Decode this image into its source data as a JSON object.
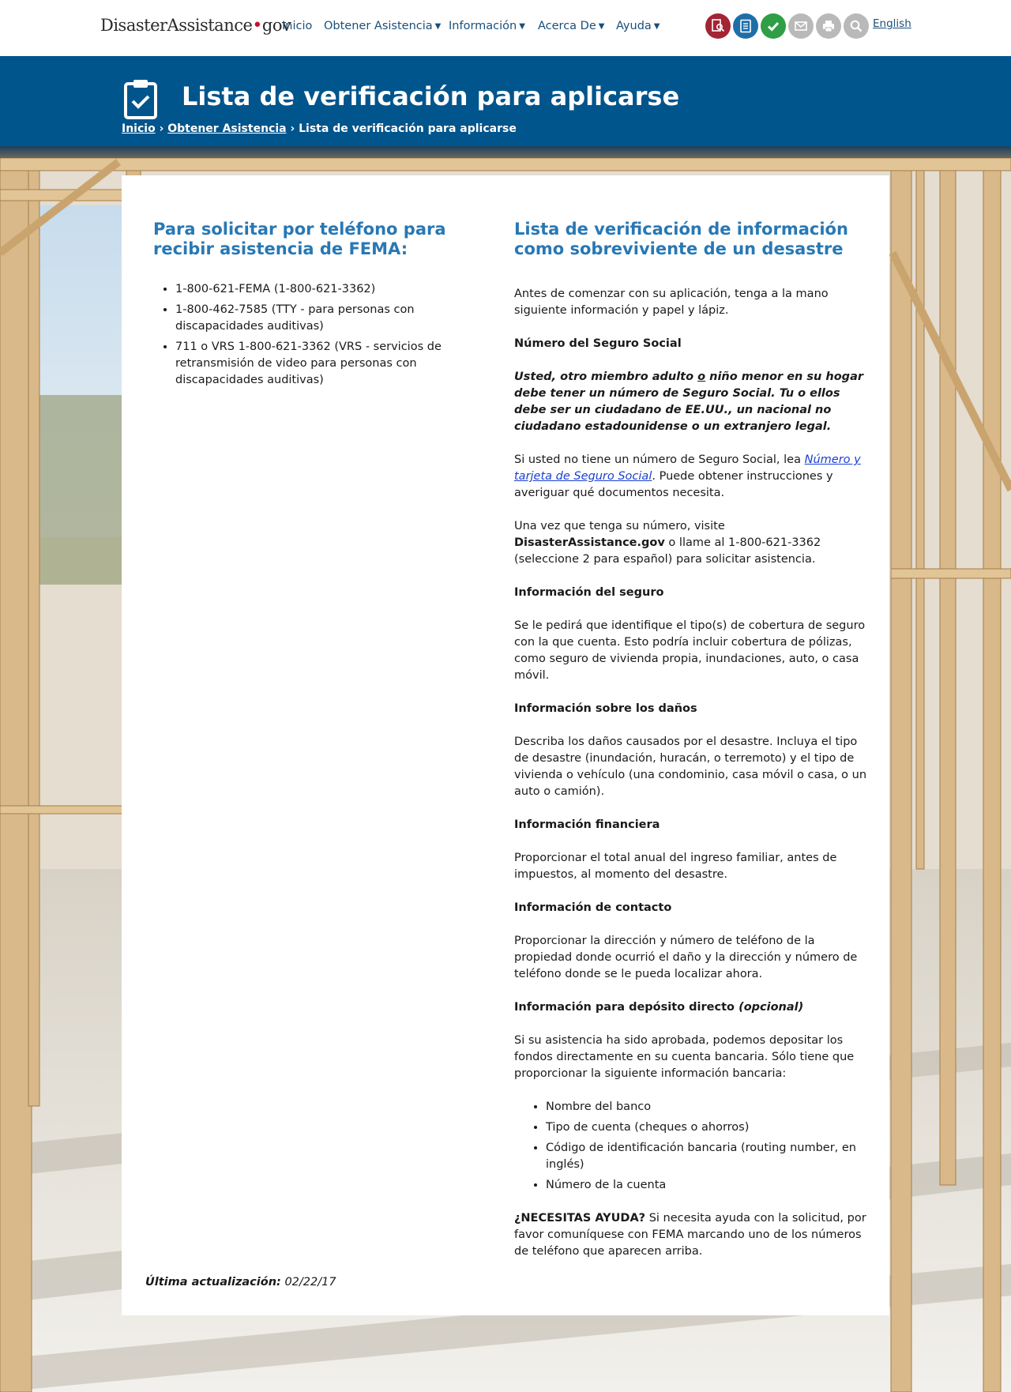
{
  "nav": {
    "logo": {
      "text_main": "DisasterAssistance",
      "text_dot": "•",
      "text_tld": "gov"
    },
    "links": [
      {
        "label": "Inicio",
        "dropdown": false
      },
      {
        "label": "Obtener Asistencia",
        "dropdown": true
      },
      {
        "label": "Información",
        "dropdown": true
      },
      {
        "label": "Acerca De",
        "dropdown": true
      },
      {
        "label": "Ayuda",
        "dropdown": true
      }
    ],
    "tools": [
      {
        "icon": "search-document-icon",
        "color": "#a32434"
      },
      {
        "icon": "checklist-icon",
        "color": "#1e6ea8"
      },
      {
        "icon": "checkmark-icon",
        "color": "#2f9e46"
      },
      {
        "icon": "email-icon",
        "color": "#b9b9b9"
      },
      {
        "icon": "print-icon",
        "color": "#b9b9b9"
      },
      {
        "icon": "search-icon",
        "color": "#b9b9b9"
      }
    ],
    "language_link": "English"
  },
  "banner": {
    "title": "Lista de verificación para aplicarse",
    "icon": "clipboard-check-icon",
    "breadcrumb": [
      {
        "label": "Inicio",
        "link": true
      },
      {
        "label": "›",
        "link": false
      },
      {
        "label": "Obtener Asistencia",
        "link": true
      },
      {
        "label": "›",
        "link": false
      },
      {
        "label": "Lista de verificación para aplicarse",
        "link": false
      }
    ]
  },
  "left": {
    "heading": "Para solicitar por teléfono para recibir asistencia de FEMA:",
    "items": [
      "1-800-621-FEMA (1-800-621-3362)",
      "1-800-462-7585 (TTY - para personas con discapacidades auditivas)",
      "711 o VRS 1-800-621-3362 (VRS - servicios de retransmisión de video para personas con discapacidades auditivas)"
    ]
  },
  "right": {
    "heading": "Lista de verificación de información como sobreviviente de un desastre",
    "intro": "Antes de comenzar con su aplicación, tenga a la mano siguiente información y papel y lápiz.",
    "ssn": {
      "title": "Número del Seguro Social",
      "note_part1": "Usted, otro miembro adulto ",
      "note_o": "o",
      "note_part2": " niño menor en su hogar debe tener un número de Seguro Social. Tu o ellos debe ser un ciudadano de EE.UU., un nacional no ciudadano estadounidense o un extranjero legal.",
      "no_ssn_part1": "Si usted no tiene un número de Seguro Social, lea ",
      "no_ssn_link": "Número y tarjeta de Seguro Social",
      "no_ssn_part2": ". Puede obtener instrucciones y averiguar qué documentos necesita.",
      "visit_part1": "Una vez que tenga su número, visite ",
      "visit_site": "DisasterAssistance.gov",
      "visit_part2": " o llame al 1-800-621-3362 (seleccione 2 para español) para solicitar asistencia."
    },
    "insurance": {
      "title": "Información del seguro",
      "body": "Se le pedirá que identifique el tipo(s) de cobertura de seguro con la que cuenta. Esto podría incluir cobertura de pólizas, como seguro de vivienda propia, inundaciones, auto, o casa móvil."
    },
    "damage": {
      "title": "Información sobre los daños",
      "body": "Describa los daños causados por el desastre. Incluya el tipo de desastre (inundación, huracán, o terremoto) y el tipo de vivienda o vehículo (una condominio, casa móvil o casa, o un auto o camión)."
    },
    "financial": {
      "title": "Información financiera",
      "body": "Proporcionar el total anual del ingreso familiar, antes de impuestos, al momento del desastre."
    },
    "contact": {
      "title": "Información de contacto",
      "body": "Proporcionar la dirección y número de teléfono de la propiedad donde ocurrió el daño y la dirección y número de teléfono donde se le pueda localizar ahora."
    },
    "deposit": {
      "title": "Información para depósito directo",
      "title_optional": "(opcional)",
      "body": "Si su asistencia ha sido aprobada, podemos depositar los fondos directamente en su cuenta bancaria. Sólo tiene que proporcionar la siguiente información bancaria:",
      "items": [
        "Nombre del banco",
        "Tipo de cuenta (cheques o ahorros)",
        "Código de identificación bancaria (routing number, en inglés)",
        "Número de la cuenta"
      ]
    },
    "help": {
      "lead": "¿NECESITAS AYUDA?",
      "body": " Si necesita ayuda con la solicitud, por favor comuníquese con FEMA marcando uno de los números de teléfono que aparecen arriba."
    }
  },
  "footer": {
    "updated_label": "Última actualización:",
    "updated_date": "02/22/17"
  },
  "colors": {
    "banner": "#00558c",
    "heading": "#2878b4",
    "nav_link": "#1a4f7a",
    "logo_dot": "#c8102e"
  }
}
